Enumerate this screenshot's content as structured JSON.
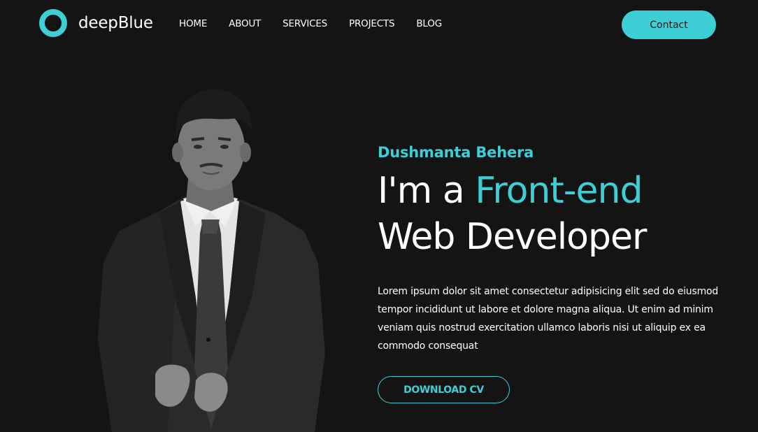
{
  "header": {
    "logo_text": "deepBlue",
    "nav": [
      {
        "label": "HOME"
      },
      {
        "label": "ABOUT"
      },
      {
        "label": "SERVICES"
      },
      {
        "label": "PROJECTS"
      },
      {
        "label": "BLOG"
      }
    ],
    "contact_label": "Contact"
  },
  "hero": {
    "name": "Dushmanta Behera",
    "headline_prefix": "I'm a ",
    "headline_accent": "Front-end",
    "headline_line2": "Web Developer",
    "description": "Lorem ipsum dolor sit amet consectetur adipisicing elit sed do eiusmod tempor incididunt ut labore et dolore magna aliqua. Ut enim ad minim veniam quis nostrud exercitation ullamco laboris nisi ut aliquip ex ea commodo consequat",
    "download_label": "DOWNLOAD CV"
  },
  "colors": {
    "accent": "#3ecfd6",
    "background": "#141414",
    "text": "#ffffff"
  },
  "icons": {
    "logo": "ring-logo-icon"
  }
}
